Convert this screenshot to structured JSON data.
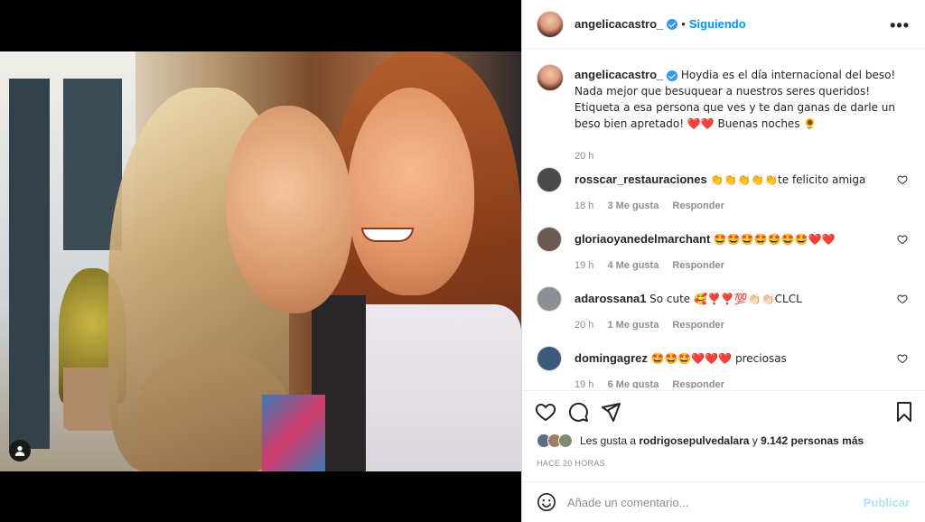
{
  "post": {
    "author": "angelicacastro_",
    "follow_label": "Siguiendo",
    "separator": "•",
    "more": "•••"
  },
  "caption": {
    "author": "angelicacastro_",
    "text": "Hoydia es el día internacional del beso! Nada mejor que besuquear a nuestros seres queridos! Etiqueta a esa persona que ves y te dan ganas de darle un beso bien apretado! ❤️❤️ Buenas noches 🌻",
    "time": "20 h"
  },
  "comments": [
    {
      "user": "rosscar_restauraciones",
      "text": "👏👏👏👏👏te felicito amiga",
      "time": "18 h",
      "likes": "3 Me gusta",
      "reply": "Responder",
      "avatar_color": "#4a4a4a"
    },
    {
      "user": "gloriaoyanedelmarchant",
      "text": "🤩🤩🤩🤩🤩🤩🤩❤️❤️",
      "time": "19 h",
      "likes": "4 Me gusta",
      "reply": "Responder",
      "avatar_color": "#6b5a52"
    },
    {
      "user": "adarossana1",
      "text": "So cute 🥰❣️❣️💯👏🏻👏🏻CLCL",
      "time": "20 h",
      "likes": "1 Me gusta",
      "reply": "Responder",
      "avatar_color": "#8a8f95"
    },
    {
      "user": "domingagrez",
      "text": "🤩🤩🤩❤️❤️❤️ preciosas",
      "time": "19 h",
      "likes": "6 Me gusta",
      "reply": "Responder",
      "avatar_color": "#3d5a7a"
    }
  ],
  "likes": {
    "prefix": "Les gusta a",
    "user": "rodrigosepulvedalara",
    "middle": "y",
    "count": "9.142 personas más"
  },
  "timestamp": "HACE 20 HORAS",
  "add_comment": {
    "placeholder": "Añade un comentario...",
    "publish": "Publicar"
  }
}
